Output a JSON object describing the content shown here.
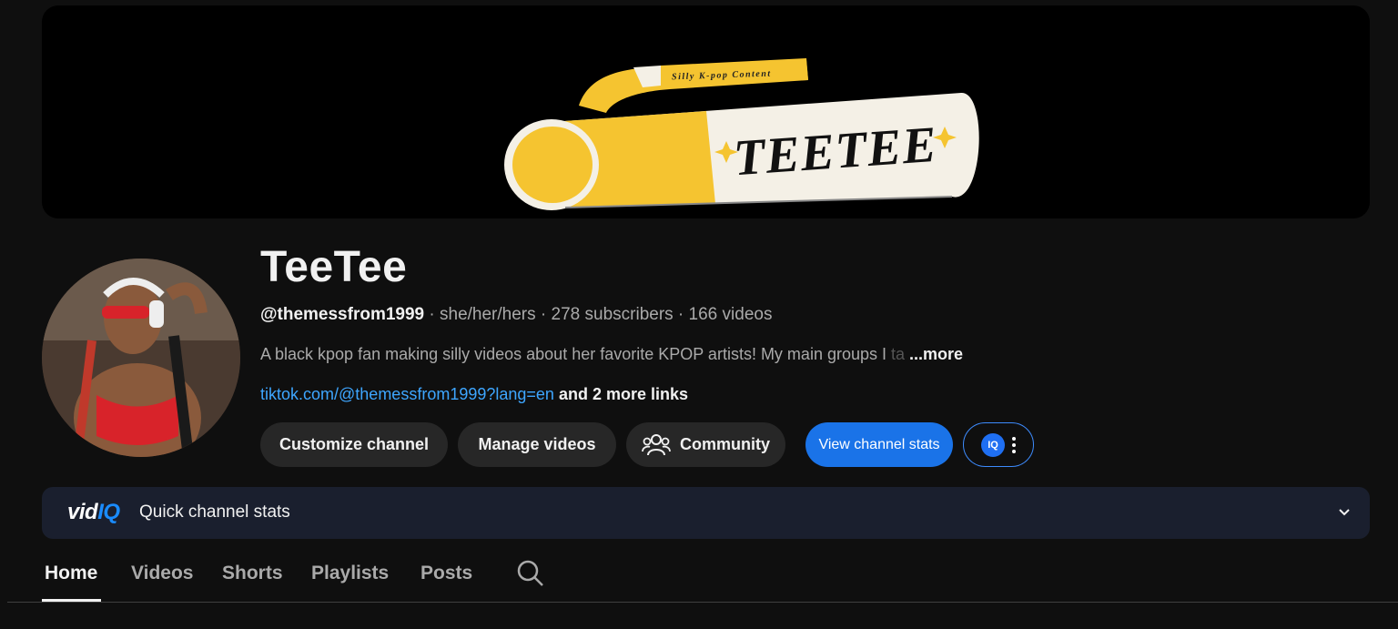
{
  "banner": {
    "tagline": "Silly K-pop Content",
    "logo_text": "TEETEE",
    "colors": {
      "yellow": "#f5c430",
      "cream": "#f4f0e6"
    }
  },
  "channel": {
    "name": "TeeTee",
    "handle": "@themessfrom1999",
    "pronouns": "she/her/hers",
    "subscribers": "278 subscribers",
    "videos": "166 videos",
    "description": "A black kpop fan making silly videos about her favorite KPOP artists! My main groups I",
    "description_fade": " ta",
    "more_label": "...more",
    "link": "tiktok.com/@themessfrom1999?lang=en",
    "more_links": "and 2 more links",
    "separator": " · "
  },
  "actions": {
    "customize": "Customize channel",
    "manage": "Manage videos",
    "community": "Community",
    "view_stats": "View channel stats",
    "vidiq_badge": "IQ"
  },
  "vidiq_bar": {
    "logo_vid": "vid",
    "logo_iq": "IQ",
    "title": "Quick channel stats"
  },
  "tabs": [
    {
      "label": "Home",
      "active": true
    },
    {
      "label": "Videos",
      "active": false
    },
    {
      "label": "Shorts",
      "active": false
    },
    {
      "label": "Playlists",
      "active": false
    },
    {
      "label": "Posts",
      "active": false
    }
  ],
  "icons": {
    "community": "people-icon",
    "search": "search-icon",
    "chevron": "chevron-down-icon",
    "more": "more-vert-icon"
  },
  "colors": {
    "background": "#0f0f0f",
    "accent_blue": "#1a73e8",
    "link_blue": "#3ea6ff",
    "vidiq_blue": "#1a8cff"
  }
}
